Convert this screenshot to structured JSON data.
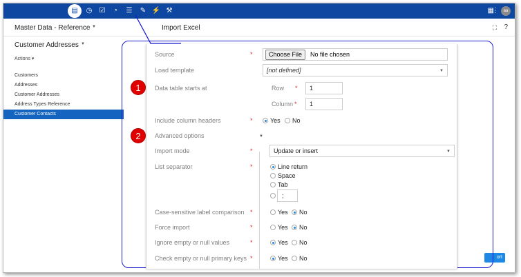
{
  "topbar": {
    "icons": [
      "database-icon",
      "clock-icon",
      "checkbox-icon",
      "gauge-icon",
      "list-icon",
      "edit-check-icon",
      "plug-icon",
      "wrench-icon"
    ],
    "right_icons": [
      "grid-menu-icon",
      "more-vert-icon"
    ],
    "avatar_initials": "aa"
  },
  "subbar": {
    "selector_label": "Master Data - Reference",
    "page_title": "Import Excel"
  },
  "sidebar": {
    "title": "Customer Addresses",
    "actions_label": "Actions",
    "items": [
      {
        "label": "Customers",
        "selected": false
      },
      {
        "label": "Addresses",
        "selected": false
      },
      {
        "label": "Customer Addresses",
        "selected": false
      },
      {
        "label": "Address Types Reference",
        "selected": false
      },
      {
        "label": "Customer Contacts",
        "selected": true
      }
    ]
  },
  "underlay": {
    "import_button_label": "ort"
  },
  "form": {
    "source": {
      "label": "Source",
      "required": "*",
      "button_label": "Choose File",
      "file_text": "No file chosen"
    },
    "load_template": {
      "label": "Load template",
      "value": "[not defined]"
    },
    "data_table": {
      "label": "Data table starts at",
      "row_label": "Row",
      "row_required": "*",
      "row_value": "1",
      "column_label": "Column",
      "column_required": "*",
      "column_value": "1"
    },
    "include_headers": {
      "label": "Include column headers",
      "required": "*",
      "options": [
        "Yes",
        "No"
      ],
      "selected": "Yes"
    },
    "advanced": {
      "label": "Advanced options"
    },
    "import_mode": {
      "label": "Import mode",
      "required": "*",
      "value": "Update or insert"
    },
    "list_separator": {
      "label": "List separator",
      "required": "*",
      "options": [
        "Line return",
        "Space",
        "Tab"
      ],
      "selected": "Line return",
      "custom_value": ";"
    },
    "case_sensitive": {
      "label": "Case-sensitive label comparison",
      "required": "*",
      "options": [
        "Yes",
        "No"
      ],
      "selected": "No"
    },
    "force_import": {
      "label": "Force import",
      "required": "*",
      "options": [
        "Yes",
        "No"
      ],
      "selected": "No"
    },
    "ignore_empty": {
      "label": "Ignore empty or null values",
      "required": "*",
      "options": [
        "Yes",
        "No"
      ],
      "selected": "Yes"
    },
    "check_empty_pk": {
      "label": "Check empty or null primary keys",
      "required": "*",
      "options": [
        "Yes",
        "No"
      ],
      "selected": "Yes"
    }
  },
  "callouts": {
    "badge_1": "1",
    "badge_2": "2"
  },
  "colors": {
    "topbar": "#0d47a1",
    "selected_item": "#1565c0",
    "callout_border": "#1a1ad1",
    "badge": "#e00000",
    "required": "#d32f2f"
  }
}
